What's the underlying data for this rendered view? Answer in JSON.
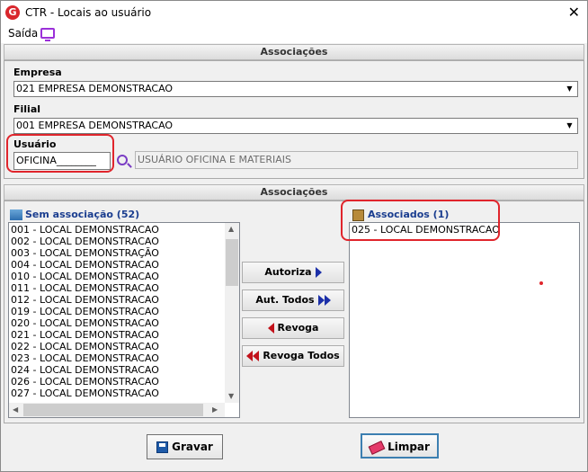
{
  "window": {
    "title": "CTR - Locais ao usuário",
    "app_icon": "G",
    "close_glyph": "✕"
  },
  "menu": {
    "saida": "Saída",
    "monitor_icon": "monitor-icon"
  },
  "section1": {
    "header": "Associações"
  },
  "empresa": {
    "label": "Empresa",
    "value": "021 EMPRESA DEMONSTRACAO"
  },
  "filial": {
    "label": "Filial",
    "value": "001 EMPRESA DEMONSTRACAO"
  },
  "usuario": {
    "label": "Usuário",
    "value": "OFICINA________",
    "description": "USUÁRIO OFICINA E MATERIAIS"
  },
  "section2": {
    "header": "Associações"
  },
  "sem_assoc": {
    "title": "Sem associação (52)",
    "items": [
      "001 - LOCAL DEMONSTRACAO",
      "002 - LOCAL DEMONSTRACAO",
      "003 - LOCAL DEMONSTRAÇÃO",
      "004 - LOCAL DEMONSTRACAO",
      "010 - LOCAL DEMONSTRACAO",
      "011 - LOCAL DEMONSTRACAO",
      "012 - LOCAL DEMONSTRACAO",
      "019 - LOCAL DEMONSTRACAO",
      "020 - LOCAL DEMONSTRACAO",
      "021 - LOCAL DEMONSTRACAO",
      "022 - LOCAL DEMONSTRACAO",
      "023 - LOCAL DEMONSTRACAO",
      "024 - LOCAL DEMONSTRACAO",
      "026 - LOCAL DEMONSTRACAO",
      "027 - LOCAL DEMONSTRACAO"
    ]
  },
  "associados": {
    "title": "Associados (1)",
    "items": [
      "025 - LOCAL DEMONSTRACAO"
    ]
  },
  "buttons": {
    "autoriza": "Autoriza",
    "aut_todos": "Aut. Todos",
    "revoga": "Revoga",
    "revoga_todos": "Revoga Todos",
    "gravar": "Gravar",
    "limpar": "Limpar"
  },
  "colors": {
    "accent_red": "#e0252c",
    "list_header_blue": "#1a3d8f",
    "icon_purple": "#7a3cc4"
  }
}
